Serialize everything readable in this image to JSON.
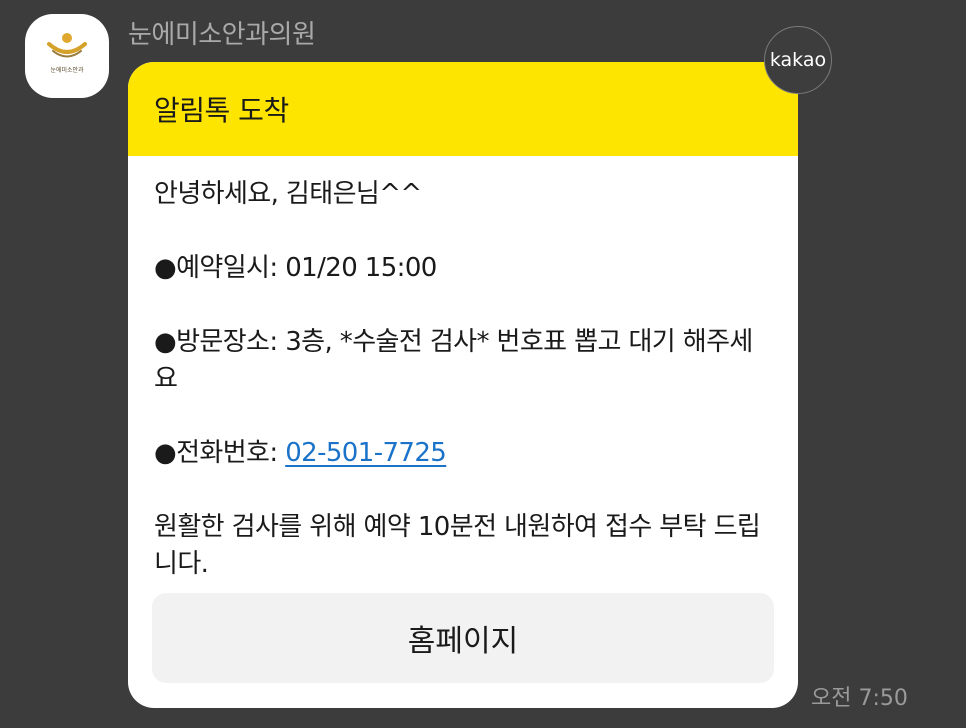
{
  "sender": {
    "name": "눈에미소안과의원",
    "avatar_icon": "clinic-logo-icon",
    "avatar_logo_text": "눈에미소안과"
  },
  "badge": {
    "label": "kakao"
  },
  "message": {
    "header_title": "알림톡 도착",
    "greeting": "안녕하세요, 김태은님^^",
    "reservation_label": "●예약일시: ",
    "reservation_value": "01/20 15:00",
    "location_label": "●방문장소: ",
    "location_value": "3층, *수술전 검사* 번호표 뽑고 대기 해주세요",
    "phone_label": "●전화번호: ",
    "phone_value": "02-501-7725",
    "notice": "원활한 검사를 위해 예약 10분전 내원하여 접수 부탁 드립니다.",
    "button_label": "홈페이지",
    "time": "오전 7:50"
  },
  "colors": {
    "background": "#3c3c3c",
    "header_yellow": "#fee500",
    "link_blue": "#1a73c8",
    "logo_gold": "#d4a12a"
  }
}
